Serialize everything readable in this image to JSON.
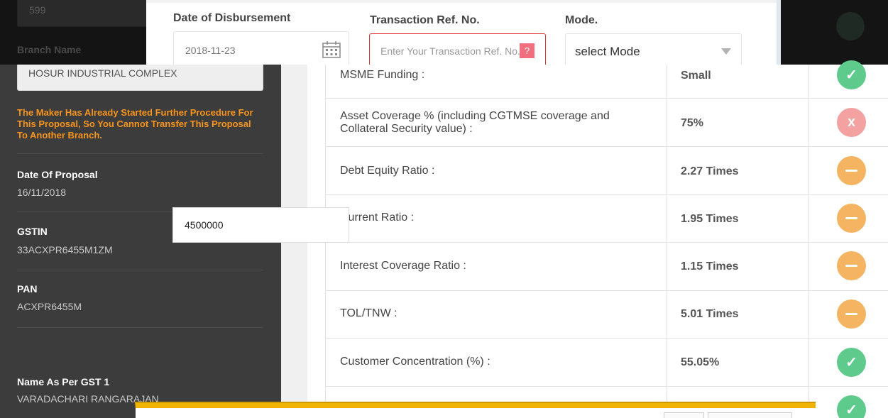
{
  "background": {
    "top_input_value": "599",
    "branch_label": "Branch Name",
    "branch_value": "HOSUR INDUSTRIAL COMPLEX"
  },
  "sidebar": {
    "warning": "The Maker Has Already Started Further Procedure For This Proposal, So You Cannot Transfer This Proposal To Another Branch.",
    "fields": [
      {
        "label": "Date Of Proposal",
        "value": "16/11/2018"
      },
      {
        "label": "GSTIN",
        "value": "33ACXPR6455M1ZM"
      },
      {
        "label": "PAN",
        "value": "ACXPR6455M"
      },
      {
        "label": "Name As Per GST 1",
        "value": "VARADACHARI RANGARAJAN"
      }
    ]
  },
  "modal": {
    "date_label": "Date of Disbursement",
    "date_value": "2018-11-23",
    "ref_label": "Transaction Ref. No.",
    "ref_placeholder": "Enter Your Transaction Ref. No.",
    "ref_help": "?",
    "mode_label": "Mode.",
    "mode_value": "select Mode"
  },
  "amount_value": "4500000",
  "table": {
    "rows": [
      {
        "param": "MSME Funding :",
        "value": "Small",
        "status": "ok"
      },
      {
        "param": "Asset Coverage % (including CGTMSE coverage and Collateral Security value) :",
        "value": "75%",
        "status": "bad"
      },
      {
        "param": "Debt Equity Ratio :",
        "value": "2.27 Times",
        "status": "mid"
      },
      {
        "param": "Current Ratio :",
        "value": "1.95 Times",
        "status": "mid"
      },
      {
        "param": "Interest Coverage Ratio :",
        "value": "1.15 Times",
        "status": "mid"
      },
      {
        "param": "TOL/TNW :",
        "value": "5.01 Times",
        "status": "mid"
      },
      {
        "param": "Customer Concentration (%) :",
        "value": "55.05%",
        "status": "ok"
      },
      {
        "param": "",
        "value": "",
        "status": "ok"
      }
    ]
  },
  "status_icons": {
    "ok": "check-icon",
    "bad": "x-icon",
    "mid": "minus-icon"
  },
  "colors": {
    "ok": "#5ecb8d",
    "bad": "#f4a1a1",
    "mid": "#f5b461",
    "warning": "#f7941d",
    "error_border": "#e03535",
    "dialog_accent": "#f0b400"
  }
}
